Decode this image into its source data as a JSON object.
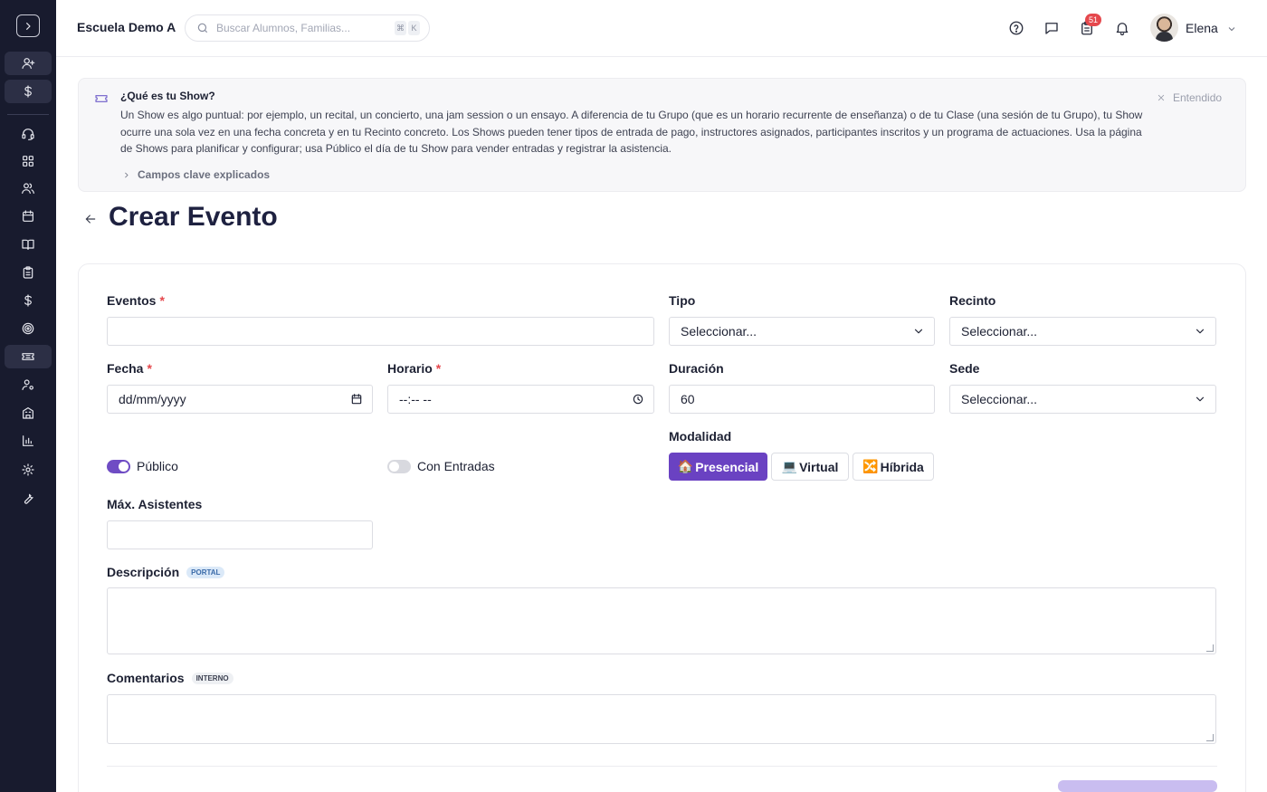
{
  "header": {
    "school_name": "Escuela Demo A",
    "search_placeholder": "Buscar Alumnos, Familias...",
    "shortcut_key1": "⌘",
    "shortcut_key2": "K",
    "notification_count": "51",
    "user_name": "Elena"
  },
  "banner": {
    "title": "¿Qué es tu Show?",
    "body": "Un Show es algo puntual: por ejemplo, un recital, un concierto, una jam session o un ensayo. A diferencia de tu Grupo (que es un horario recurrente de enseñanza) o de tu Clase (una sesión de tu Grupo), tu Show ocurre una sola vez en una fecha concreta y en tu Recinto concreto. Los Shows pueden tener tipos de entrada de pago, instructores asignados, participantes inscritos y un programa de actuaciones. Usa la página de Shows para planificar y configurar; usa Público el día de tu Show para vender entradas y registrar la asistencia.",
    "dismiss_label": "Entendido",
    "expander_label": "Campos clave explicados"
  },
  "page": {
    "title": "Crear Evento"
  },
  "form": {
    "eventos_label": "Eventos",
    "eventos_value": "",
    "tipo_label": "Tipo",
    "tipo_value": "Seleccionar...",
    "recinto_label": "Recinto",
    "recinto_value": "Seleccionar...",
    "fecha_label": "Fecha",
    "fecha_placeholder": "dd/mm/yyyy",
    "horario_label": "Horario",
    "horario_placeholder": "--:-- --",
    "duracion_label": "Duración",
    "duracion_value": "60",
    "sede_label": "Sede",
    "sede_value": "Seleccionar...",
    "publico_label": "Público",
    "publico_on": true,
    "entradas_label": "Con Entradas",
    "entradas_on": false,
    "modalidad_label": "Modalidad",
    "modalidad_options": [
      {
        "emoji": "🏠",
        "label": "Presencial",
        "selected": true
      },
      {
        "emoji": "💻",
        "label": "Virtual",
        "selected": false
      },
      {
        "emoji": "🔀",
        "label": "Híbrida",
        "selected": false
      }
    ],
    "max_label": "Máx. Asistentes",
    "max_value": "",
    "descripcion_label": "Descripción",
    "descripcion_tag": "PORTAL",
    "comentarios_label": "Comentarios",
    "comentarios_tag": "INTERNO"
  },
  "icons": {
    "sidebar": [
      "chevron-right-icon",
      "user-plus-icon",
      "dollar-icon",
      "headset-icon",
      "dashboard-icon",
      "users-icon",
      "calendar-icon",
      "book-icon",
      "clipboard-icon",
      "dollar-icon",
      "target-icon",
      "ticket-icon",
      "user-settings-icon",
      "building-icon",
      "chart-icon",
      "gear-icon",
      "wrench-icon"
    ],
    "header": [
      "help-icon",
      "chat-icon",
      "clipboard-icon",
      "bell-icon"
    ]
  },
  "colors": {
    "sidebar_bg": "#181b2e",
    "accent": "#6a42c2",
    "required": "#e5484d"
  }
}
